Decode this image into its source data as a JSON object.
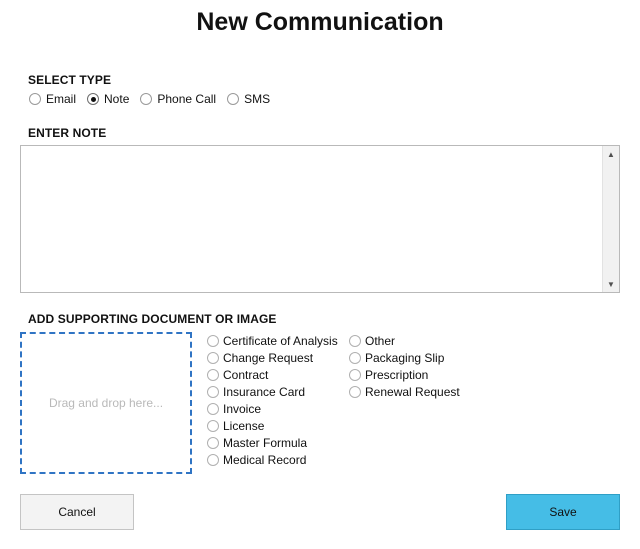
{
  "title": "New Communication",
  "select_type": {
    "label": "SELECT TYPE",
    "options": [
      {
        "label": "Email",
        "checked": false
      },
      {
        "label": "Note",
        "checked": true
      },
      {
        "label": "Phone Call",
        "checked": false
      },
      {
        "label": "SMS",
        "checked": false
      }
    ]
  },
  "note": {
    "label": "ENTER NOTE",
    "value": "",
    "scroll_up_icon": "▲",
    "scroll_down_icon": "▼"
  },
  "document": {
    "label": "ADD SUPPORTING DOCUMENT OR IMAGE",
    "dropzone_text": "Drag and drop here...",
    "types_col1": [
      "Certificate of Analysis",
      "Change Request",
      "Contract",
      "Insurance Card",
      "Invoice",
      "License",
      "Master Formula",
      "Medical Record"
    ],
    "types_col2": [
      "Other",
      "Packaging Slip",
      "Prescription",
      "Renewal Request"
    ]
  },
  "buttons": {
    "cancel": "Cancel",
    "save": "Save"
  },
  "colors": {
    "save_bg": "#45bde6",
    "dropzone_border": "#2f74c4"
  }
}
